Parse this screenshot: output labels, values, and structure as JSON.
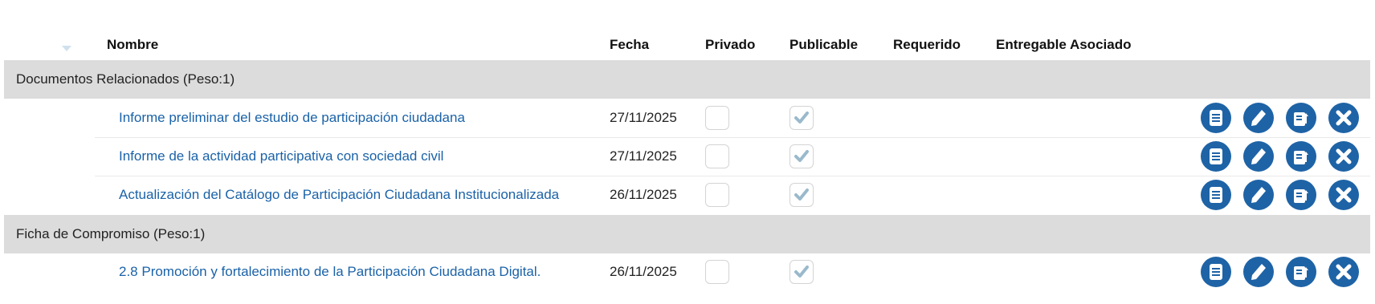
{
  "table": {
    "columns": {
      "nombre": "Nombre",
      "fecha": "Fecha",
      "privado": "Privado",
      "publicable": "Publicable",
      "requerido": "Requerido",
      "entregable": "Entregable Asociado"
    },
    "groups": [
      {
        "title": "Documentos Relacionados (Peso:1)",
        "rows": [
          {
            "name": "Informe preliminar del estudio de participación ciudadana",
            "date": "27/11/2025",
            "privado": false,
            "publicable": true
          },
          {
            "name": "Informe de la actividad participativa con sociedad civil",
            "date": "27/11/2025",
            "privado": false,
            "publicable": true
          },
          {
            "name": "Actualización del Catálogo de Participación Ciudadana Institucionalizada",
            "date": "26/11/2025",
            "privado": false,
            "publicable": true
          }
        ]
      },
      {
        "title": "Ficha de Compromiso (Peso:1)",
        "rows": [
          {
            "name": "2.8 Promoción y fortalecimiento de la Participación Ciudadana Digital.",
            "date": "26/11/2025",
            "privado": false,
            "publicable": true
          }
        ]
      }
    ]
  },
  "row_actions": [
    "document-icon",
    "pencil-icon",
    "export-icon",
    "close-icon"
  ],
  "colors": {
    "link": "#1a62a8",
    "action": "#1e63a6",
    "group_bg": "#dcdcdc"
  }
}
